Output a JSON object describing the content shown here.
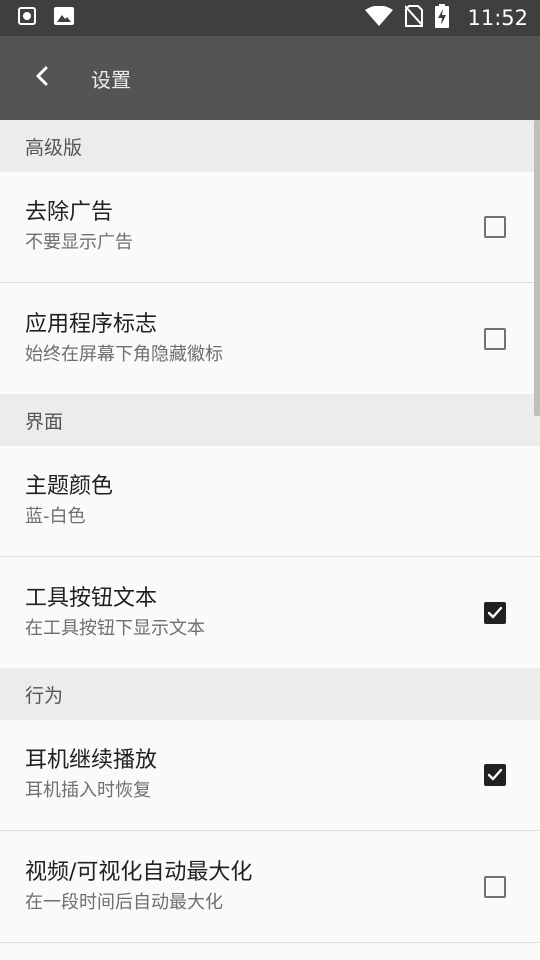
{
  "status_bar": {
    "time": "11:52",
    "icons": [
      "screenshot-notification-icon",
      "image-notification-icon",
      "wifi-icon",
      "no-sim-icon",
      "battery-charging-icon"
    ]
  },
  "toolbar": {
    "title": "设置",
    "back_icon": "chevron-left-icon"
  },
  "sections": [
    {
      "header": "高级版",
      "items": [
        {
          "title": "去除广告",
          "subtitle": "不要显示广告",
          "checked": false
        },
        {
          "title": "应用程序标志",
          "subtitle": "始终在屏幕下角隐藏徽标",
          "checked": false
        }
      ]
    },
    {
      "header": "界面",
      "items": [
        {
          "title": "主题颜色",
          "subtitle": "蓝-白色"
        },
        {
          "title": "工具按钮文本",
          "subtitle": "在工具按钮下显示文本",
          "checked": true
        }
      ]
    },
    {
      "header": "行为",
      "items": [
        {
          "title": "耳机继续播放",
          "subtitle": "耳机插入时恢复",
          "checked": true
        },
        {
          "title": "视频/可视化自动最大化",
          "subtitle": "在一段时间后自动最大化",
          "checked": false
        }
      ]
    }
  ],
  "colors": {
    "status_bar": "#3f3f3f",
    "toolbar": "#545454",
    "section_header_bg": "#ececec",
    "checkbox_checked": "#212121"
  }
}
